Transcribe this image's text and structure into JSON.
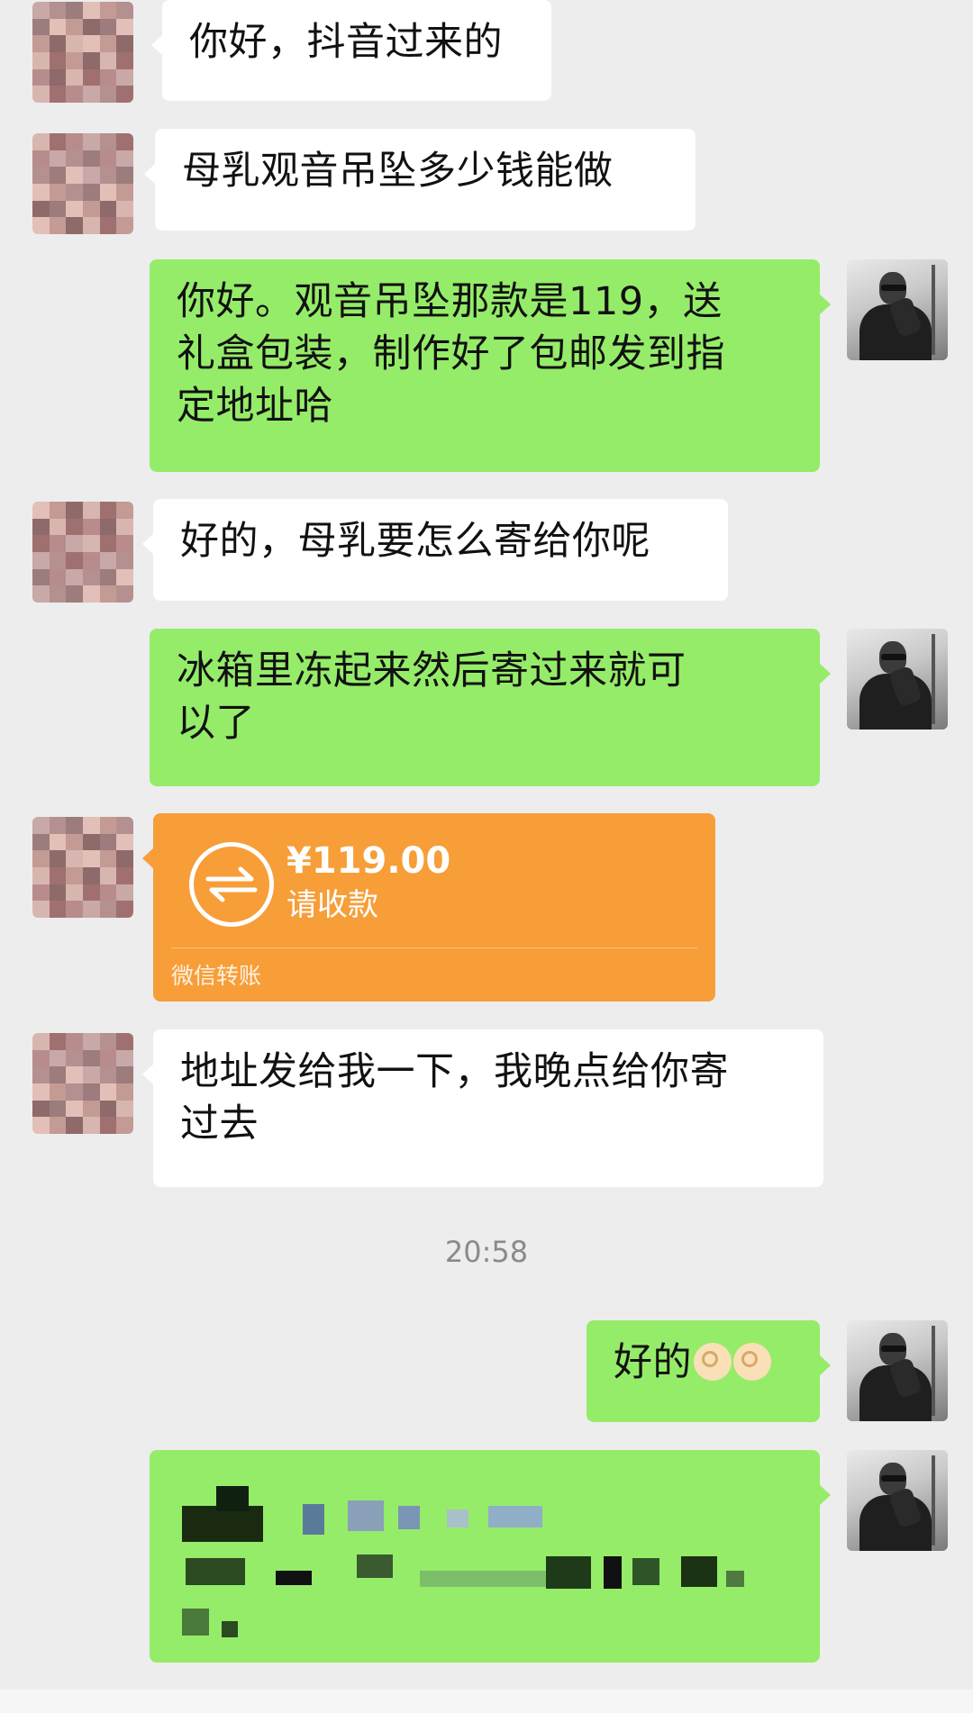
{
  "messages": [
    {
      "side": "in",
      "text": "你好，抖音过来的"
    },
    {
      "side": "in",
      "text": "母乳观音吊坠多少钱能做"
    },
    {
      "side": "out",
      "text_lines": [
        "你好。观音吊坠那款是119，送",
        "礼盒包装，制作好了包邮发到指",
        "定地址哈"
      ]
    },
    {
      "side": "in",
      "text": "好的，母乳要怎么寄给你呢"
    },
    {
      "side": "out",
      "text_lines": [
        "冰箱里冻起来然后寄过来就可",
        "以了"
      ]
    },
    {
      "side": "in",
      "type": "transfer"
    },
    {
      "side": "in",
      "text_lines": [
        "地址发给我一下，我晚点给你寄",
        "过去"
      ]
    },
    {
      "side": "out",
      "text": "好的",
      "emoji": [
        "ok-hand-icon",
        "ok-hand-icon"
      ]
    },
    {
      "side": "out",
      "type": "redacted-address"
    }
  ],
  "transfer": {
    "amount": "¥119.00",
    "status": "请收款",
    "footer": "微信转账"
  },
  "timestamp": "20:58",
  "colors": {
    "background": "#ededed",
    "incoming_bubble": "#ffffff",
    "outgoing_bubble": "#95ec69",
    "transfer_card": "#f79e39"
  }
}
